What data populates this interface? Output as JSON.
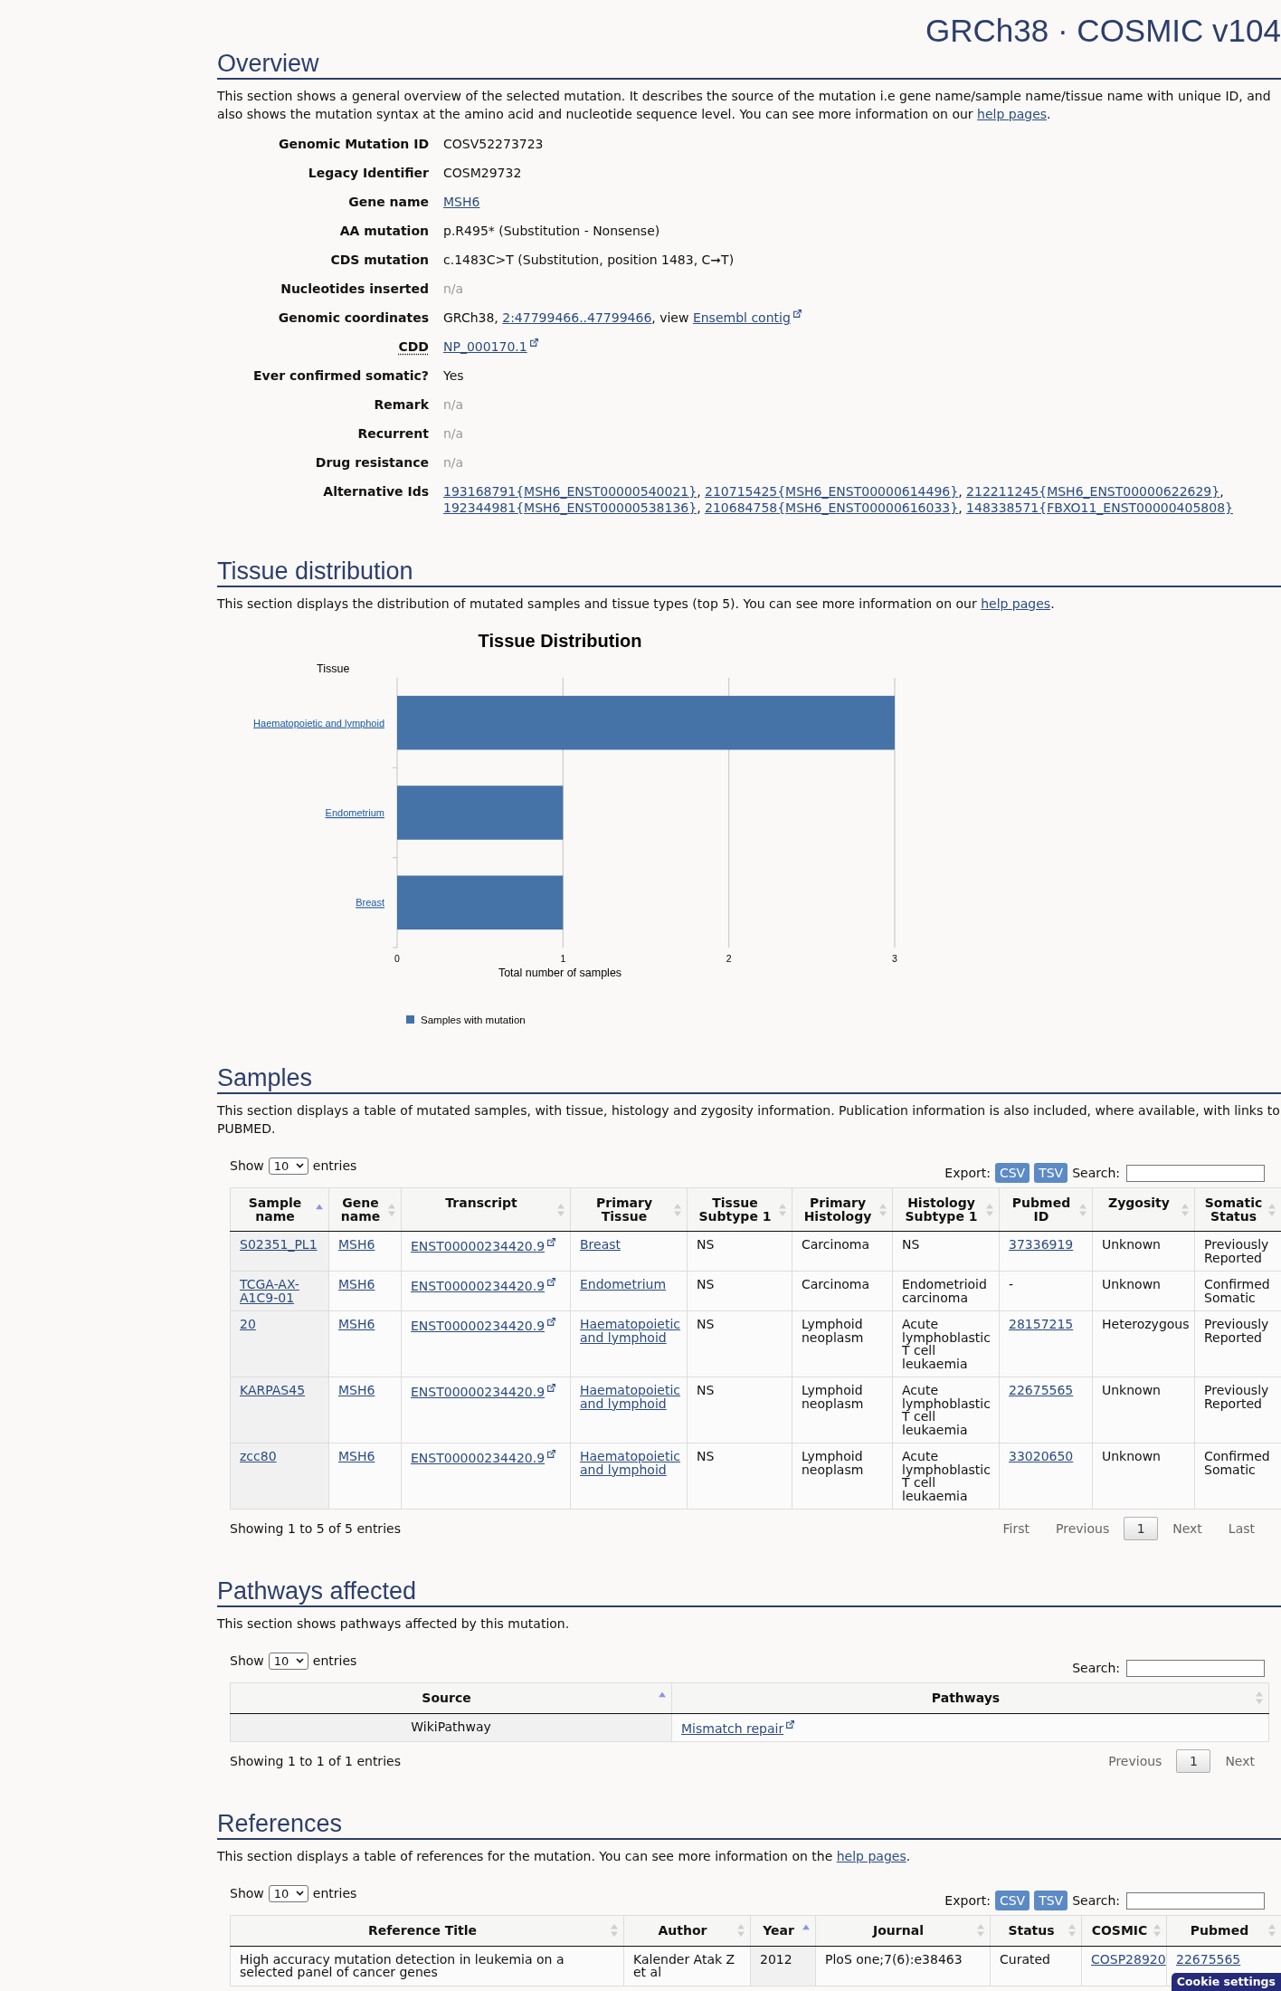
{
  "header": {
    "title": "GRCh38 · COSMIC v104"
  },
  "overview": {
    "heading": "Overview",
    "intro": {
      "text": "This section shows a general overview of the selected mutation. It describes the source of the mutation i.e gene name/sample name/tissue name with unique ID, and also shows the mutation syntax at the amino acid and nucleotide sequence level. You can see more information on our ",
      "link": "help pages",
      "after": "."
    },
    "fields": [
      {
        "label": "Genomic Mutation ID",
        "abbreviated": false,
        "value": [
          {
            "kind": "text",
            "text": "COSV52273723"
          }
        ]
      },
      {
        "label": "Legacy Identifier",
        "abbreviated": false,
        "value": [
          {
            "kind": "text",
            "text": "COSM29732"
          }
        ]
      },
      {
        "label": "Gene name",
        "abbreviated": false,
        "value": [
          {
            "kind": "link",
            "text": "MSH6"
          }
        ]
      },
      {
        "label": "AA mutation",
        "abbreviated": false,
        "value": [
          {
            "kind": "text",
            "text": "p.R495* (Substitution - Nonsense)"
          }
        ]
      },
      {
        "label": "CDS mutation",
        "abbreviated": false,
        "value": [
          {
            "kind": "text",
            "text": "c.1483C>T (Substitution, position 1483, C➞T)"
          }
        ]
      },
      {
        "label": "Nucleotides inserted",
        "abbreviated": false,
        "value": [
          {
            "kind": "na",
            "text": "n/a"
          }
        ]
      },
      {
        "label": "Genomic coordinates",
        "abbreviated": false,
        "value": [
          {
            "kind": "text",
            "text": "GRCh38, "
          },
          {
            "kind": "link",
            "text": "2:47799466..47799466"
          },
          {
            "kind": "text",
            "text": ", view "
          },
          {
            "kind": "external_link",
            "text": "Ensembl contig"
          }
        ]
      },
      {
        "label": "CDD",
        "abbreviated": true,
        "value": [
          {
            "kind": "external_link",
            "text": "NP_000170.1"
          }
        ]
      },
      {
        "label": "Ever confirmed somatic?",
        "abbreviated": false,
        "value": [
          {
            "kind": "text",
            "text": "Yes"
          }
        ]
      },
      {
        "label": "Remark",
        "abbreviated": false,
        "value": [
          {
            "kind": "na",
            "text": "n/a"
          }
        ]
      },
      {
        "label": "Recurrent",
        "abbreviated": false,
        "value": [
          {
            "kind": "na",
            "text": "n/a"
          }
        ]
      },
      {
        "label": "Drug resistance",
        "abbreviated": false,
        "value": [
          {
            "kind": "na",
            "text": "n/a"
          }
        ]
      },
      {
        "label": "Alternative Ids",
        "abbreviated": false,
        "value": [
          {
            "kind": "link",
            "text": "193168791{MSH6_ENST00000540021}"
          },
          {
            "kind": "text",
            "text": ", "
          },
          {
            "kind": "link",
            "text": "210715425{MSH6_ENST00000614496}"
          },
          {
            "kind": "text",
            "text": ", "
          },
          {
            "kind": "link",
            "text": "212211245{MSH6_ENST00000622629}"
          },
          {
            "kind": "text",
            "text": ", "
          },
          {
            "kind": "link",
            "text": "192344981{MSH6_ENST00000538136}"
          },
          {
            "kind": "text",
            "text": ", "
          },
          {
            "kind": "link",
            "text": "210684758{MSH6_ENST00000616033}"
          },
          {
            "kind": "text",
            "text": ", "
          },
          {
            "kind": "link",
            "text": "148338571{FBXO11_ENST00000405808}"
          }
        ]
      }
    ]
  },
  "tissue_distribution": {
    "heading": "Tissue distribution",
    "intro": {
      "text": "This section displays the distribution of mutated samples and tissue types (top 5). You can see more information on our ",
      "link": "help pages",
      "after": "."
    },
    "chart_data": {
      "type": "bar",
      "orientation": "horizontal",
      "title": "Tissue Distribution",
      "ylabel": "Tissue",
      "xlabel": "Total number of samples",
      "categories": [
        "Haematopoietic and lymphoid",
        "Endometrium",
        "Breast"
      ],
      "series": [
        {
          "name": "Samples with mutation",
          "color": "#4572a7",
          "values": [
            3,
            1,
            1
          ]
        }
      ],
      "xlim": [
        0,
        3
      ],
      "xticks": [
        0,
        1,
        2,
        3
      ]
    }
  },
  "samples": {
    "heading": "Samples",
    "intro": {
      "text": "This section displays a table of mutated samples, with tissue, histology and zygosity information. Publication information is also included, where available, with links to PUBMED."
    },
    "length_menu": {
      "before": "Show",
      "value": "10",
      "after": "entries"
    },
    "export": {
      "label": "Export:",
      "buttons": [
        "CSV",
        "TSV"
      ]
    },
    "search": {
      "label": "Search:"
    },
    "columns": [
      {
        "label": "Sample name",
        "sortable": true,
        "sorted": true
      },
      {
        "label": "Gene name",
        "sortable": true,
        "sorted": false
      },
      {
        "label": "Transcript",
        "sortable": true,
        "sorted": false
      },
      {
        "label": "Primary Tissue",
        "sortable": true,
        "sorted": false
      },
      {
        "label": "Tissue Subtype 1",
        "sortable": true,
        "sorted": false
      },
      {
        "label": "Primary Histology",
        "sortable": true,
        "sorted": false
      },
      {
        "label": "Histology Subtype 1",
        "sortable": true,
        "sorted": false
      },
      {
        "label": "Pubmed ID",
        "sortable": true,
        "sorted": false
      },
      {
        "label": "Zygosity",
        "sortable": true,
        "sorted": false
      },
      {
        "label": "Somatic Status",
        "sortable": true,
        "sorted": false
      }
    ],
    "rows": [
      {
        "cells": [
          {
            "kind": "link",
            "text": "S02351_PL1"
          },
          {
            "kind": "link",
            "text": "MSH6"
          },
          {
            "kind": "external_link",
            "text": "ENST00000234420.9"
          },
          {
            "kind": "link",
            "text": "Breast"
          },
          {
            "kind": "text",
            "text": "NS"
          },
          {
            "kind": "text",
            "text": "Carcinoma"
          },
          {
            "kind": "text",
            "text": "NS"
          },
          {
            "kind": "link",
            "text": "37336919"
          },
          {
            "kind": "text",
            "text": "Unknown"
          },
          {
            "kind": "text",
            "text": "Previously Reported"
          }
        ]
      },
      {
        "cells": [
          {
            "kind": "link",
            "text": "TCGA-AX-A1C9-01"
          },
          {
            "kind": "link",
            "text": "MSH6"
          },
          {
            "kind": "external_link",
            "text": "ENST00000234420.9"
          },
          {
            "kind": "link",
            "text": "Endometrium"
          },
          {
            "kind": "text",
            "text": "NS"
          },
          {
            "kind": "text",
            "text": "Carcinoma"
          },
          {
            "kind": "text",
            "text": "Endometrioid carcinoma"
          },
          {
            "kind": "text",
            "text": "-"
          },
          {
            "kind": "text",
            "text": "Unknown"
          },
          {
            "kind": "text",
            "text": "Confirmed Somatic"
          }
        ]
      },
      {
        "cells": [
          {
            "kind": "link",
            "text": "20"
          },
          {
            "kind": "link",
            "text": "MSH6"
          },
          {
            "kind": "external_link",
            "text": "ENST00000234420.9"
          },
          {
            "kind": "link",
            "text": "Haematopoietic and lymphoid"
          },
          {
            "kind": "text",
            "text": "NS"
          },
          {
            "kind": "text",
            "text": "Lymphoid neoplasm"
          },
          {
            "kind": "text",
            "text": "Acute lymphoblastic T cell leukaemia"
          },
          {
            "kind": "link",
            "text": "28157215"
          },
          {
            "kind": "text",
            "text": "Heterozygous"
          },
          {
            "kind": "text",
            "text": "Previously Reported"
          }
        ]
      },
      {
        "cells": [
          {
            "kind": "link",
            "text": "KARPAS45"
          },
          {
            "kind": "link",
            "text": "MSH6"
          },
          {
            "kind": "external_link",
            "text": "ENST00000234420.9"
          },
          {
            "kind": "link",
            "text": "Haematopoietic and lymphoid"
          },
          {
            "kind": "text",
            "text": "NS"
          },
          {
            "kind": "text",
            "text": "Lymphoid neoplasm"
          },
          {
            "kind": "text",
            "text": "Acute lymphoblastic T cell leukaemia"
          },
          {
            "kind": "link",
            "text": "22675565"
          },
          {
            "kind": "text",
            "text": "Unknown"
          },
          {
            "kind": "text",
            "text": "Previously Reported"
          }
        ]
      },
      {
        "cells": [
          {
            "kind": "link",
            "text": "zcc80"
          },
          {
            "kind": "link",
            "text": "MSH6"
          },
          {
            "kind": "external_link",
            "text": "ENST00000234420.9"
          },
          {
            "kind": "link",
            "text": "Haematopoietic and lymphoid"
          },
          {
            "kind": "text",
            "text": "NS"
          },
          {
            "kind": "text",
            "text": "Lymphoid neoplasm"
          },
          {
            "kind": "text",
            "text": "Acute lymphoblastic T cell leukaemia"
          },
          {
            "kind": "link",
            "text": "33020650"
          },
          {
            "kind": "text",
            "text": "Unknown"
          },
          {
            "kind": "text",
            "text": "Confirmed Somatic"
          }
        ]
      }
    ],
    "info": "Showing 1 to 5 of 5 entries",
    "pagination": [
      {
        "kind": "first",
        "label": "First",
        "disabled": true,
        "selected": false
      },
      {
        "kind": "previous",
        "label": "Previous",
        "disabled": true,
        "selected": false
      },
      {
        "kind": "page",
        "label": "1",
        "disabled": false,
        "selected": true
      },
      {
        "kind": "next",
        "label": "Next",
        "disabled": true,
        "selected": false
      },
      {
        "kind": "last",
        "label": "Last",
        "disabled": true,
        "selected": false
      }
    ]
  },
  "pathways": {
    "heading": "Pathways affected",
    "intro": {
      "text": "This section shows pathways affected by this mutation."
    },
    "length_menu": {
      "before": "Show",
      "value": "10",
      "after": "entries"
    },
    "search": {
      "label": "Search:"
    },
    "columns": [
      {
        "label": "Source",
        "sortable": true,
        "sorted": true
      },
      {
        "label": "Pathways",
        "sortable": true,
        "sorted": false
      }
    ],
    "rows": [
      {
        "cells": [
          {
            "kind": "text",
            "text": "WikiPathway"
          },
          {
            "kind": "external_link",
            "text": "Mismatch repair"
          }
        ]
      }
    ],
    "info": "Showing 1 to 1 of 1 entries",
    "pagination": [
      {
        "kind": "previous",
        "label": "Previous",
        "disabled": true,
        "selected": false
      },
      {
        "kind": "page",
        "label": "1",
        "disabled": false,
        "selected": true
      },
      {
        "kind": "next",
        "label": "Next",
        "disabled": true,
        "selected": false
      }
    ]
  },
  "references": {
    "heading": "References",
    "intro": {
      "text": "This section displays a table of references for the mutation. You can see more information on the ",
      "link": "help pages",
      "after": "."
    },
    "length_menu": {
      "before": "Show",
      "value": "10",
      "after": "entries"
    },
    "export": {
      "label": "Export:",
      "buttons": [
        "CSV",
        "TSV"
      ]
    },
    "search": {
      "label": "Search:"
    },
    "columns": [
      {
        "label": "Reference Title",
        "sortable": true,
        "sorted": false
      },
      {
        "label": "Author",
        "sortable": true,
        "sorted": false
      },
      {
        "label": "Year",
        "sortable": true,
        "sorted": true
      },
      {
        "label": "Journal",
        "sortable": true,
        "sorted": false
      },
      {
        "label": "Status",
        "sortable": true,
        "sorted": false
      },
      {
        "label": "COSMIC",
        "sortable": true,
        "sorted": false
      },
      {
        "label": "Pubmed",
        "sortable": true,
        "sorted": false
      }
    ],
    "rows": [
      {
        "cells": [
          {
            "kind": "text",
            "text": "High accuracy mutation detection in leukemia on a selected panel of cancer genes"
          },
          {
            "kind": "text",
            "text": "Kalender Atak Z et al"
          },
          {
            "kind": "text",
            "text": "2012"
          },
          {
            "kind": "text",
            "text": "PloS one;7(6):e38463"
          },
          {
            "kind": "text",
            "text": "Curated"
          },
          {
            "kind": "link",
            "text": "COSP28920"
          },
          {
            "kind": "link",
            "text": "22675565"
          }
        ]
      }
    ]
  },
  "cookie_button": {
    "label": "Cookie settings"
  }
}
